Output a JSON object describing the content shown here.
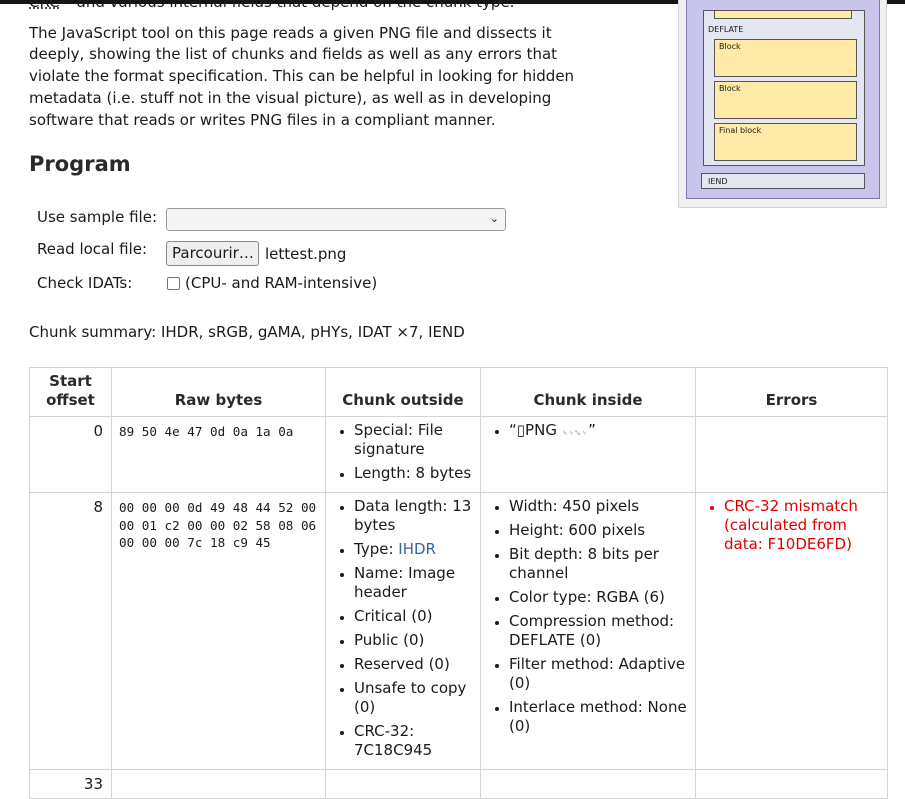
{
  "intro": {
    "crc_link": "CRC",
    "line1_rest": " – and various internal fields that depend on the chunk type.",
    "paragraph": "The JavaScript tool on this page reads a given PNG file and dissects it deeply, showing the list of chunks and fields as well as any errors that violate the format specification. This can be helpful in looking for hidden metadata (i.e. stuff not in the visual picture), as well as in developing software that reads or writes PNG files in a compliant manner."
  },
  "figure": {
    "deflate": "DEFLATE",
    "blocks": [
      "Block",
      "Block",
      "Final block"
    ],
    "iend": "IEND"
  },
  "program": {
    "title": "Program",
    "sample_label": "Use sample file:",
    "sample_value": "",
    "local_label": "Read local file:",
    "browse_button": "Parcourir…",
    "file_name": "lettest.png",
    "check_label": "Check IDATs:",
    "check_hint": "(CPU- and RAM-intensive)",
    "check_checked": false
  },
  "summary": "Chunk summary: IHDR, sRGB, gAMA, pHYs, IDAT ×7, IEND",
  "table": {
    "headers": {
      "offset": "Start offset",
      "raw": "Raw bytes",
      "outside": "Chunk outside",
      "inside": "Chunk inside",
      "errors": "Errors"
    },
    "rows": [
      {
        "offset": "0",
        "raw": "89 50 4e 47 0d 0a 1a 0a",
        "outside": [
          "Special: File signature",
          "Length: 8 bytes"
        ],
        "inside_sig_open": "“",
        "inside_sig_mid": "PNG",
        "inside_sig_close": "”",
        "errors": []
      },
      {
        "offset": "8",
        "raw": "00 00 00 0d 49 48 44 52 00 00 01 c2 00 00 02 58 08 06 00 00 00 7c 18 c9 45",
        "outside": {
          "data_length": "Data length: 13 bytes",
          "type_prefix": "Type: ",
          "type_link": "IHDR",
          "name": "Name: Image header",
          "critical": "Critical (0)",
          "public": "Public (0)",
          "reserved": "Reserved (0)",
          "unsafe": "Unsafe to copy (0)",
          "crc": "CRC-32: 7C18C945"
        },
        "inside": [
          "Width: 450 pixels",
          "Height: 600 pixels",
          "Bit depth: 8 bits per channel",
          "Color type: RGBA (6)",
          "Compression method: DEFLATE (0)",
          "Filter method: Adaptive (0)",
          "Interlace method: None (0)"
        ],
        "errors": [
          "CRC-32 mismatch (calculated from data: F10DE6FD)"
        ]
      },
      {
        "offset": "33"
      }
    ]
  },
  "colors": {
    "link": "#3465a4",
    "error": "#e00000",
    "figure_outer": "#c9c4ec",
    "figure_block": "#ffeaa8"
  }
}
